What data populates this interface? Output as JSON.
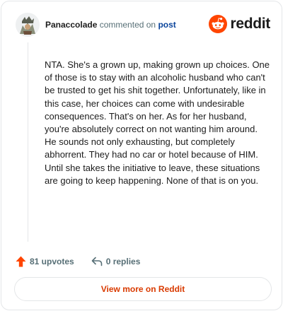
{
  "header": {
    "username": "Panaccolade",
    "action": "commented on",
    "target": "post"
  },
  "brand": {
    "name": "reddit",
    "icon": "reddit-logo-icon",
    "color": "#ff4500"
  },
  "comment": {
    "text": "NTA. She's a grown up, making grown up choices. One of those is to stay with an alcoholic husband who can't be trusted to get his shit together. Unfortunately, like in this case, her choices can come with undesirable consequences. That's on her. As for her husband, you're absolutely correct on not wanting him around. He sounds not only exhausting, but completely abhorrent. They had no car or hotel because of HIM. Until she takes the initiative to leave, these situations are going to keep happening. None of that is on you."
  },
  "stats": {
    "upvotes": "81 upvotes",
    "upvote_icon": "upvote-arrow-icon",
    "upvote_color": "#ff4500",
    "replies": "0 replies",
    "reply_icon": "reply-arrow-icon"
  },
  "footer": {
    "view_more": "View more on Reddit",
    "accent": "#d93a00"
  }
}
